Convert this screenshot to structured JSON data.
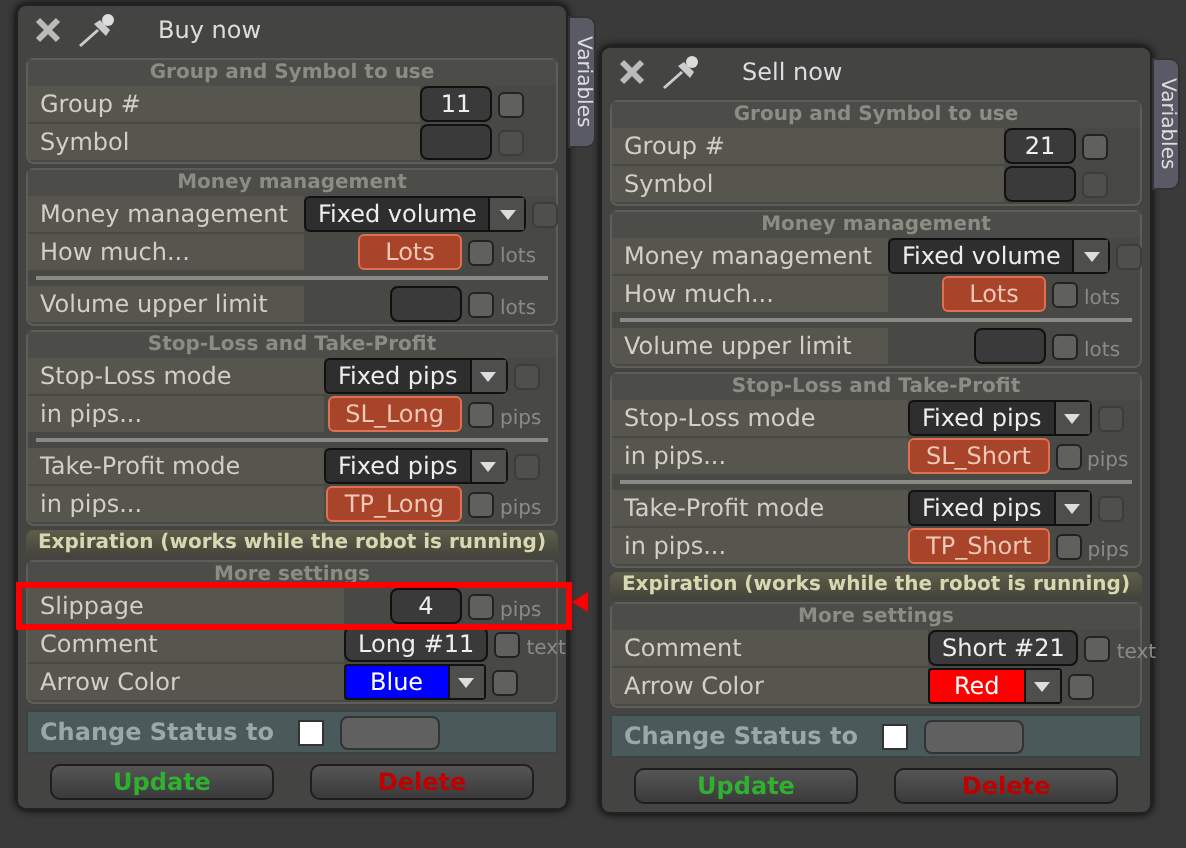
{
  "panels": [
    {
      "title": "Buy now",
      "tab_label": "Variables",
      "sections": [
        {
          "kind": "header",
          "title": "Group and Symbol to use",
          "rows": [
            {
              "label": "Group #",
              "control": {
                "kind": "number",
                "value": "11"
              },
              "check_disabled": false
            },
            {
              "label": "Symbol",
              "control": {
                "kind": "number"
              },
              "check_disabled": true
            }
          ]
        },
        {
          "kind": "header",
          "title": "Money management",
          "rows": [
            {
              "label": "Money management",
              "control": {
                "kind": "dropdown",
                "value": "Fixed volume"
              },
              "check_disabled": true
            },
            {
              "label": "How much...",
              "control": {
                "kind": "chip",
                "value": "Lots"
              },
              "check_disabled": false,
              "unit": "lots"
            },
            {
              "label": "Volume upper limit",
              "control": {
                "kind": "number"
              },
              "check_disabled": false,
              "unit": "lots",
              "divider_before": true
            }
          ]
        },
        {
          "kind": "header",
          "title": "Stop-Loss and Take-Profit",
          "rows": [
            {
              "label": "Stop-Loss mode",
              "control": {
                "kind": "dropdown",
                "value": "Fixed pips"
              },
              "check_disabled": true
            },
            {
              "label": "in pips...",
              "control": {
                "kind": "chip",
                "value": "SL_Long"
              },
              "check_disabled": false,
              "unit": "pips"
            },
            {
              "label": "Take-Profit mode",
              "control": {
                "kind": "dropdown",
                "value": "Fixed pips"
              },
              "check_disabled": true,
              "divider_before": true
            },
            {
              "label": "in pips...",
              "control": {
                "kind": "chip",
                "value": "TP_Long"
              },
              "check_disabled": false,
              "unit": "pips"
            }
          ]
        },
        {
          "kind": "expiration",
          "title": "Expiration (works while the robot is running)"
        },
        {
          "kind": "header",
          "title": "More settings",
          "rows": [
            {
              "label": "Slippage",
              "control": {
                "kind": "number",
                "value": "4"
              },
              "check_disabled": false,
              "unit": "pips",
              "highlighted": true
            },
            {
              "label": "Comment",
              "control": {
                "kind": "number",
                "value": "Long #11"
              },
              "check_disabled": false,
              "unit": "text"
            },
            {
              "label": "Arrow Color",
              "control": {
                "kind": "color",
                "value": "Blue",
                "color": "#0000ff"
              },
              "check_disabled": false
            }
          ]
        }
      ],
      "status_label": "Change Status to",
      "status_checked": false,
      "buttons": [
        {
          "kind": "update",
          "label": "Update"
        },
        {
          "kind": "delete",
          "label": "Delete"
        }
      ]
    },
    {
      "title": "Sell now",
      "tab_label": "Variables",
      "sections": [
        {
          "kind": "header",
          "title": "Group and Symbol to use",
          "rows": [
            {
              "label": "Group #",
              "control": {
                "kind": "number",
                "value": "21"
              },
              "check_disabled": false
            },
            {
              "label": "Symbol",
              "control": {
                "kind": "number"
              },
              "check_disabled": true
            }
          ]
        },
        {
          "kind": "header",
          "title": "Money management",
          "rows": [
            {
              "label": "Money management",
              "control": {
                "kind": "dropdown",
                "value": "Fixed volume"
              },
              "check_disabled": true
            },
            {
              "label": "How much...",
              "control": {
                "kind": "chip",
                "value": "Lots"
              },
              "check_disabled": false,
              "unit": "lots"
            },
            {
              "label": "Volume upper limit",
              "control": {
                "kind": "number"
              },
              "check_disabled": false,
              "unit": "lots",
              "divider_before": true
            }
          ]
        },
        {
          "kind": "header",
          "title": "Stop-Loss and Take-Profit",
          "rows": [
            {
              "label": "Stop-Loss mode",
              "control": {
                "kind": "dropdown",
                "value": "Fixed pips"
              },
              "check_disabled": true
            },
            {
              "label": "in pips...",
              "control": {
                "kind": "chip",
                "value": "SL_Short"
              },
              "check_disabled": false,
              "unit": "pips"
            },
            {
              "label": "Take-Profit mode",
              "control": {
                "kind": "dropdown",
                "value": "Fixed pips"
              },
              "check_disabled": true,
              "divider_before": true
            },
            {
              "label": "in pips...",
              "control": {
                "kind": "chip",
                "value": "TP_Short"
              },
              "check_disabled": false,
              "unit": "pips"
            }
          ]
        },
        {
          "kind": "expiration",
          "title": "Expiration (works while the robot is running)"
        },
        {
          "kind": "header",
          "title": "More settings",
          "rows": [
            {
              "label": "Comment",
              "control": {
                "kind": "number",
                "value": "Short #21"
              },
              "check_disabled": false,
              "unit": "text"
            },
            {
              "label": "Arrow Color",
              "control": {
                "kind": "color",
                "value": "Red",
                "color": "#ff0000"
              },
              "check_disabled": false
            }
          ]
        }
      ],
      "status_label": "Change Status to",
      "status_checked": false,
      "buttons": [
        {
          "kind": "update",
          "label": "Update"
        },
        {
          "kind": "delete",
          "label": "Delete"
        }
      ]
    }
  ]
}
